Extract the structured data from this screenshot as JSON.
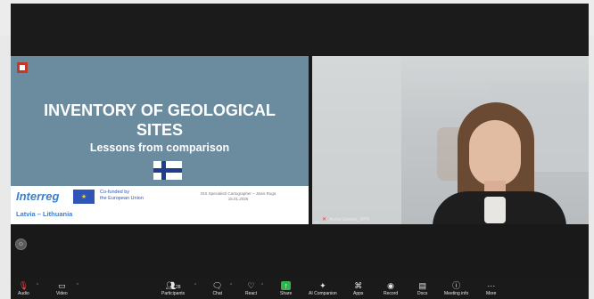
{
  "slide": {
    "logo_text": "",
    "title_line1": "INVENTORY OF GEOLOGICAL",
    "title_line2": "SITES",
    "subtitle": "Lessons from comparison",
    "footer": {
      "brand": "Interreg",
      "cofunded_line1": "Co-funded by",
      "cofunded_line2": "the European Union",
      "credits_line1": "GIS Specialist/ Cartographer – Jānis Ruga",
      "credits_line2": "15.01.2026",
      "region": "Latvia – Lithuania"
    }
  },
  "participant": {
    "name": "Anna Upsala_KPK"
  },
  "toolbar": {
    "audio": "Audio",
    "video": "Video",
    "participants": "Participants",
    "participants_count": "28",
    "chat": "Chat",
    "react": "React",
    "share": "Share",
    "ai_companion": "AI Companion",
    "apps": "Apps",
    "record": "Record",
    "docs": "Docs",
    "meeting_info": "Meeting info",
    "more": "More"
  }
}
